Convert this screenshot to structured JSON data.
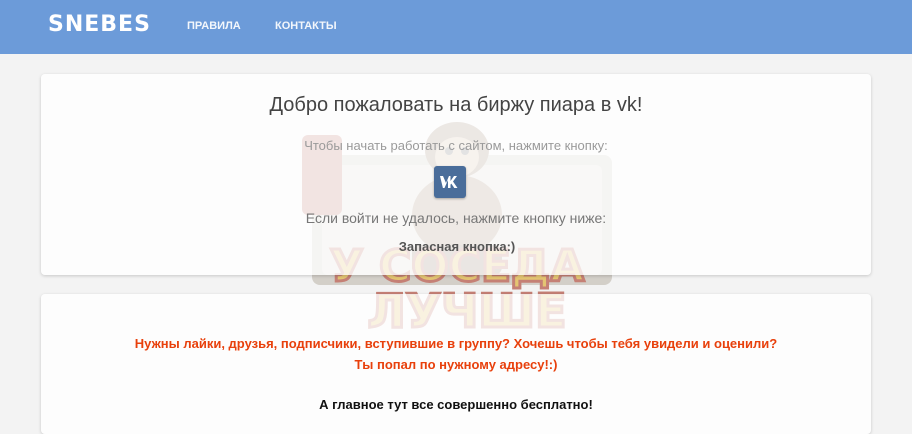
{
  "navbar": {
    "brand": "SNEBES",
    "links": [
      {
        "label": "ПРАВИЛА"
      },
      {
        "label": "КОНТАКТЫ"
      }
    ],
    "color": "#6c9bd9"
  },
  "welcome": {
    "title": "Добро пожаловать на биржу пиара в vk!",
    "hint": "Чтобы начать работать с сайтом, нажмите кнопку:",
    "login_icon": "vk-logo-icon",
    "fallback_text": "Если войти не удалось, нажмите кнопку ниже:",
    "backup_button": "Запасная кнопка:)"
  },
  "info": {
    "promo_line1": "Нужны лайки, друзья, подписчики, вступившие в группу? Хочешь чтобы тебя увидели и оценили?",
    "promo_line2": "Ты попал по нужному адресу!:)",
    "free_line": "А главное тут все совершенно бесплатно!",
    "accent_color": "#e8400c"
  },
  "watermark": {
    "text_line1": "У СОСЕДА",
    "text_line2": "ЛУЧШЕ"
  }
}
